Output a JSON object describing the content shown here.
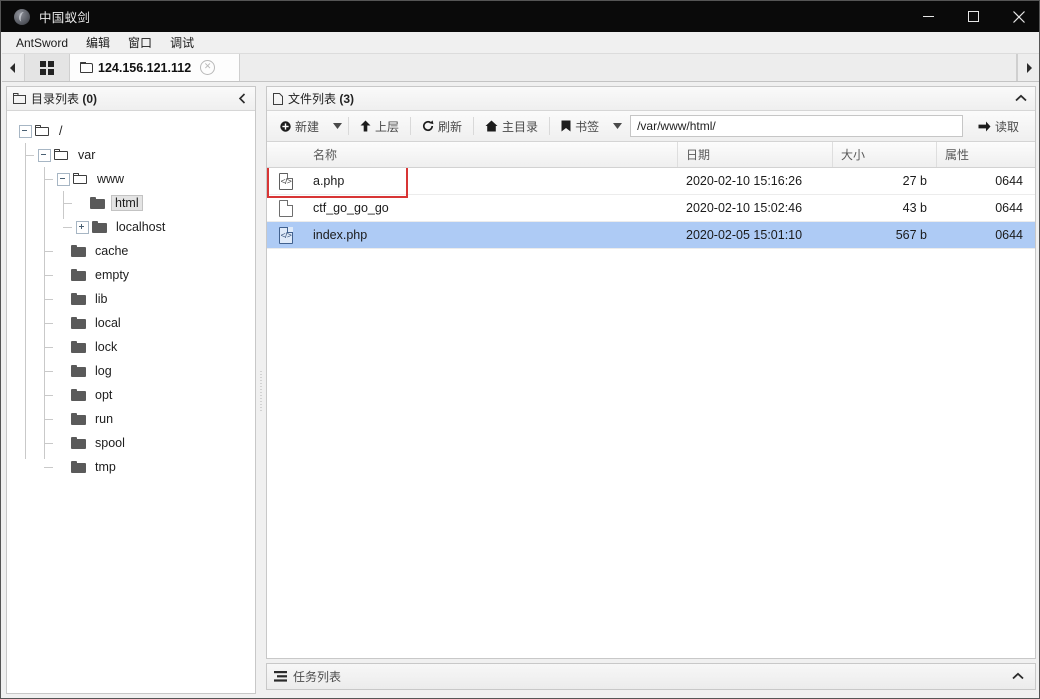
{
  "window": {
    "title": "中国蚁剑",
    "logo_icon": "antsword-logo-icon",
    "minimize_icon": "minimize-icon",
    "maximize_icon": "maximize-icon",
    "close_icon": "close-icon"
  },
  "menubar": {
    "items": [
      {
        "label": "AntSword"
      },
      {
        "label": "编辑"
      },
      {
        "label": "窗口"
      },
      {
        "label": "调试"
      }
    ]
  },
  "tabstrip": {
    "left_arrow_icon": "chevron-left-icon",
    "right_arrow_icon": "chevron-right-icon",
    "grid_icon": "grid-icon",
    "tabs": [
      {
        "folder_icon": "folder-icon",
        "label": "124.156.121.112",
        "close_icon": "close-circle-icon",
        "active": true
      }
    ]
  },
  "sidebar": {
    "header": {
      "icon": "folder-icon",
      "title": "目录列表",
      "count": "(0)",
      "collapse_icon": "chevron-left-icon"
    },
    "tree": [
      {
        "label": "/",
        "depth": 0,
        "expander": "minus",
        "folder": "outline",
        "selected": false
      },
      {
        "label": "var",
        "depth": 1,
        "expander": "minus",
        "folder": "outline",
        "selected": false
      },
      {
        "label": "www",
        "depth": 2,
        "expander": "minus",
        "folder": "outline",
        "selected": false
      },
      {
        "label": "html",
        "depth": 3,
        "expander": "none",
        "folder": "solid",
        "selected": true
      },
      {
        "label": "localhost",
        "depth": 3,
        "expander": "plus",
        "folder": "solid",
        "selected": false
      },
      {
        "label": "cache",
        "depth": 2,
        "expander": "none",
        "folder": "solid",
        "selected": false
      },
      {
        "label": "empty",
        "depth": 2,
        "expander": "none",
        "folder": "solid",
        "selected": false
      },
      {
        "label": "lib",
        "depth": 2,
        "expander": "none",
        "folder": "solid",
        "selected": false
      },
      {
        "label": "local",
        "depth": 2,
        "expander": "none",
        "folder": "solid",
        "selected": false
      },
      {
        "label": "lock",
        "depth": 2,
        "expander": "none",
        "folder": "solid",
        "selected": false
      },
      {
        "label": "log",
        "depth": 2,
        "expander": "none",
        "folder": "solid",
        "selected": false
      },
      {
        "label": "opt",
        "depth": 2,
        "expander": "none",
        "folder": "solid",
        "selected": false
      },
      {
        "label": "run",
        "depth": 2,
        "expander": "none",
        "folder": "solid",
        "selected": false
      },
      {
        "label": "spool",
        "depth": 2,
        "expander": "none",
        "folder": "solid",
        "selected": false
      },
      {
        "label": "tmp",
        "depth": 2,
        "expander": "none",
        "folder": "solid",
        "selected": false
      }
    ]
  },
  "filelist": {
    "header": {
      "icon": "file-icon",
      "title": "文件列表",
      "count": "(3)",
      "collapse_icon": "chevron-up-icon"
    },
    "toolbar": {
      "new_label": "新建",
      "new_icon": "plus-circle-icon",
      "new_caret_icon": "caret-down-icon",
      "up_label": "上层",
      "up_icon": "arrow-up-icon",
      "refresh_label": "刷新",
      "refresh_icon": "refresh-icon",
      "home_label": "主目录",
      "home_icon": "home-icon",
      "bookmark_label": "书签",
      "bookmark_icon": "bookmark-icon",
      "bookmark_caret_icon": "caret-down-icon",
      "path_value": "/var/www/html/",
      "path_placeholder": "",
      "read_label": "读取",
      "read_icon": "arrow-right-icon"
    },
    "columns": [
      "",
      "名称",
      "日期",
      "大小",
      "属性"
    ],
    "rows": [
      {
        "icon": "php-file-icon",
        "name": "a.php",
        "date": "2020-02-10 15:16:26",
        "size": "27 b",
        "attr": "0644",
        "selected": false,
        "highlighted": true
      },
      {
        "icon": "plain-file-icon",
        "name": "ctf_go_go_go",
        "date": "2020-02-10 15:02:46",
        "size": "43 b",
        "attr": "0644",
        "selected": false,
        "highlighted": false
      },
      {
        "icon": "php-file-icon",
        "name": "index.php",
        "date": "2020-02-05 15:01:10",
        "size": "567 b",
        "attr": "0644",
        "selected": true,
        "highlighted": false
      }
    ]
  },
  "taskbar": {
    "icon": "list-icon",
    "label": "任务列表",
    "expand_icon": "chevron-up-icon"
  },
  "colors": {
    "titlebar_bg": "#0a0a0a",
    "selection_blue": "#aecbf5",
    "highlight_red": "#d83535",
    "panel_bg": "#f0f0f0"
  }
}
